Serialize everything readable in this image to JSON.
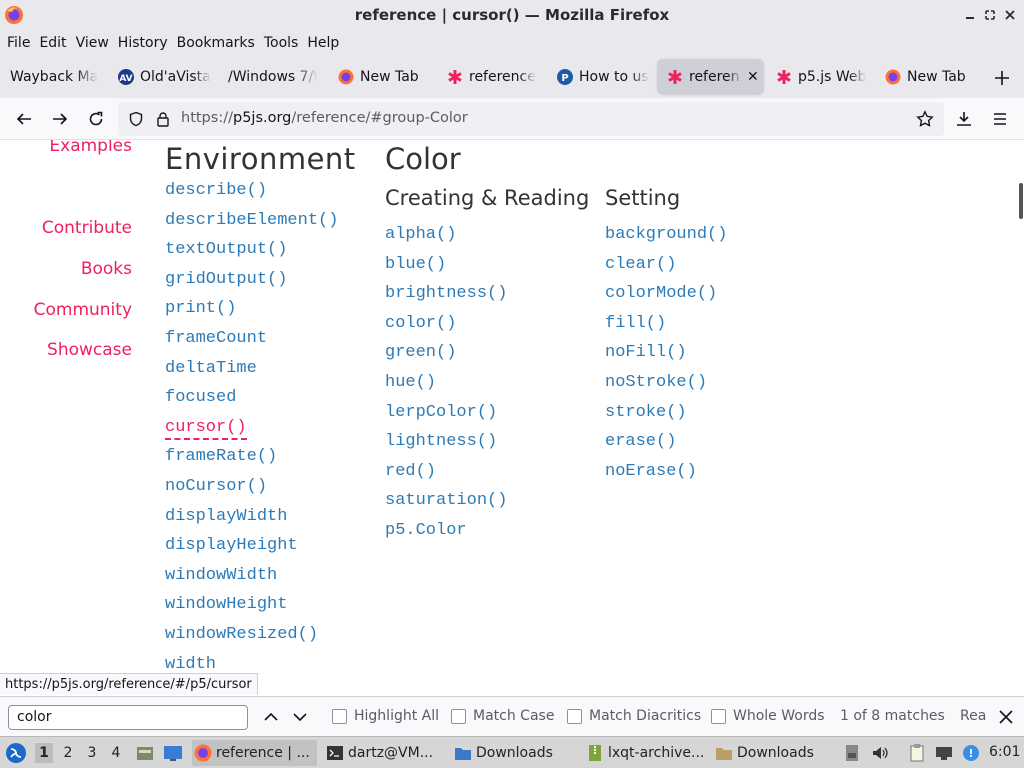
{
  "window": {
    "title": "reference | cursor() — Mozilla Firefox"
  },
  "menu": [
    "File",
    "Edit",
    "View",
    "History",
    "Bookmarks",
    "Tools",
    "Help"
  ],
  "tabs": [
    {
      "label": "Wayback Ma",
      "icon": "none"
    },
    {
      "label": "Old'aVista",
      "icon": "altavista-icon"
    },
    {
      "label": "/Windows 7/\\",
      "icon": "none"
    },
    {
      "label": "New Tab",
      "icon": "firefox-icon"
    },
    {
      "label": "reference",
      "icon": "p5-asterisk-icon"
    },
    {
      "label": "How to us",
      "icon": "p-icon"
    },
    {
      "label": "referen",
      "icon": "p5-asterisk-icon"
    },
    {
      "label": "p5.js Web",
      "icon": "p5-asterisk-icon"
    },
    {
      "label": "New Tab",
      "icon": "firefox-icon"
    }
  ],
  "address": {
    "prefix": "https://",
    "domain": "p5js.org",
    "path": "/reference/#group-Color"
  },
  "sidebar": [
    "Examples",
    "Contribute",
    "Books",
    "Community",
    "Showcase"
  ],
  "environment": {
    "heading": "Environment",
    "items": [
      "describe()",
      "describeElement()",
      "textOutput()",
      "gridOutput()",
      "print()",
      "frameCount",
      "deltaTime",
      "focused",
      "cursor()",
      "frameRate()",
      "noCursor()",
      "displayWidth",
      "displayHeight",
      "windowWidth",
      "windowHeight",
      "windowResized()",
      "width"
    ]
  },
  "color": {
    "heading": "Color",
    "creating": {
      "heading": "Creating & Reading",
      "items": [
        "alpha()",
        "blue()",
        "brightness()",
        "color()",
        "green()",
        "hue()",
        "lerpColor()",
        "lightness()",
        "red()",
        "saturation()",
        "p5.Color"
      ]
    },
    "setting": {
      "heading": "Setting",
      "items": [
        "background()",
        "clear()",
        "colorMode()",
        "fill()",
        "noFill()",
        "noStroke()",
        "stroke()",
        "erase()",
        "noErase()"
      ]
    }
  },
  "status_url": "https://p5js.org/reference/#/p5/cursor",
  "findbar": {
    "query": "color",
    "highlight_all": "Highlight All",
    "match_case": "Match Case",
    "match_diacritics": "Match Diacritics",
    "whole_words": "Whole Words",
    "matches": "1 of 8 matches",
    "extra": "Rea"
  },
  "taskbar": {
    "workspaces": [
      "1",
      "2",
      "3",
      "4"
    ],
    "apps": [
      {
        "label": "reference | ..."
      },
      {
        "label": "dartz@VM..."
      },
      {
        "label": "Downloads"
      },
      {
        "label": "lxqt-archive..."
      },
      {
        "label": "Downloads"
      }
    ],
    "clock": "6:01"
  },
  "colors": {
    "p5_pink": "#ed225d",
    "link_blue": "#2d7bb6",
    "chrome": "#e9e9ed"
  }
}
